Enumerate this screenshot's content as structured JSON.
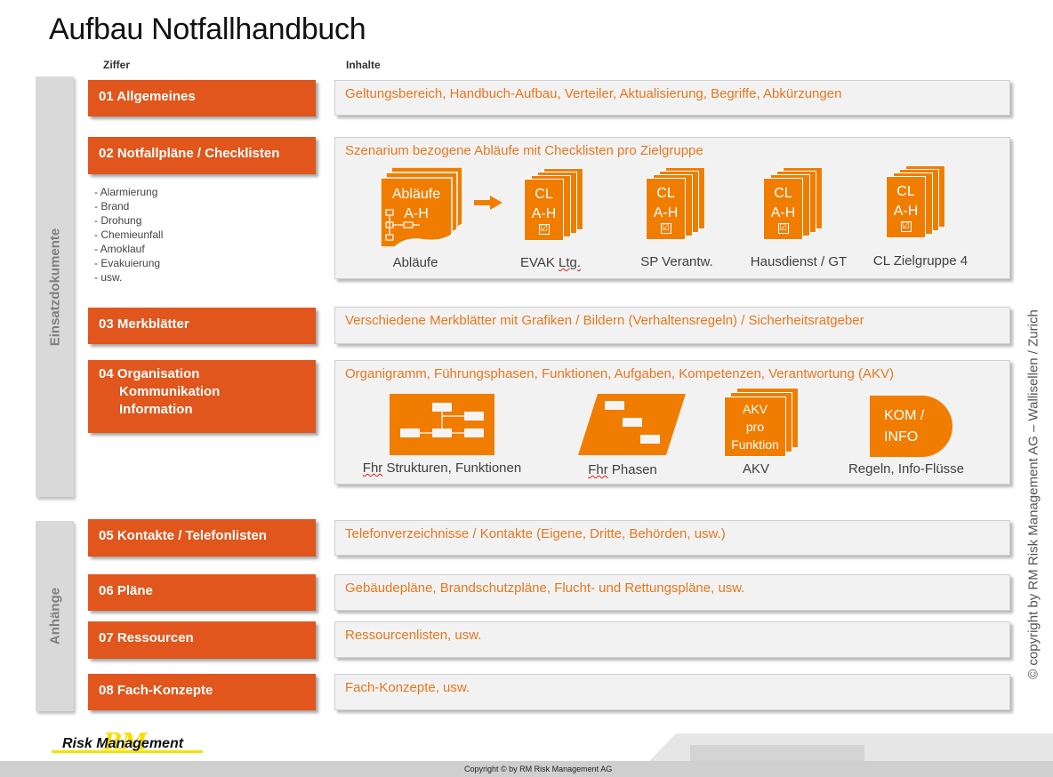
{
  "title": "Aufbau Notfallhandbuch",
  "headers": {
    "ziffer": "Ziffer",
    "inhalte": "Inhalte"
  },
  "sidebars": {
    "einsatz": "Einsatzdokumente",
    "anhaenge": "Anhänge"
  },
  "items": {
    "i01": "01  Allgemeines",
    "i02": "02 Notfallpläne / Checklisten",
    "i03": "03 Merkblätter",
    "i04": {
      "l1": "04 Organisation",
      "l2": "Kommunikation",
      "l3": "Information"
    },
    "i05": "05 Kontakte / Telefonlisten",
    "i06": "06 Pläne",
    "i07": "07 Ressourcen",
    "i08": "08 Fach-Konzepte"
  },
  "sublist": [
    "- Alarmierung",
    "- Brand",
    "- Drohung",
    "- Chemieunfall",
    "- Amoklauf",
    "- Evakuierung",
    "- usw."
  ],
  "contents": {
    "c01": "Geltungsbereich, Handbuch-Aufbau, Verteiler, Aktualisierung, Begriffe, Abkürzungen",
    "c02": "Szenarium bezogene Abläufe mit Checklisten pro Zielgruppe",
    "c03": "Verschiedene Merkblätter mit Grafiken / Bildern (Verhaltensregeln) / Sicherheitsratgeber",
    "c04": "Organigramm, Führungsphasen, Funktionen, Aufgaben, Kompetenzen, Verantwortung (AKV)",
    "c05": "Telefonverzeichnisse / Kontakte (Eigene, Dritte, Behörden, usw.)",
    "c06": "Gebäudepläne, Brandschutzpläne, Flucht- und Rettungspläne, usw.",
    "c07": "Ressourcenlisten, usw.",
    "c08": "Fach-Konzepte, usw."
  },
  "row2_graphics": {
    "ablaeufe_icon": {
      "l1": "Abläufe",
      "l2": "A-H"
    },
    "cl_icon": {
      "l1": "CL",
      "l2": "A-H",
      "check": "☑"
    },
    "captions": {
      "ablaeufe": "Abläufe",
      "evak_a": "EVAK",
      "evak_b": "Ltg.",
      "sp": "SP Verantw.",
      "haus": "Hausdienst / GT",
      "cl4": "CL Zielgruppe 4"
    }
  },
  "row4_graphics": {
    "akv_icon": {
      "l1": "AKV",
      "l2": "pro",
      "l3": "Funktion"
    },
    "kom_icon": {
      "l1": "KOM /",
      "l2": "INFO"
    },
    "captions": {
      "fhr1_a": "Fhr",
      "fhr1_b": "Strukturen, Funktionen",
      "fhr2_a": "Fhr",
      "fhr2_b": "Phasen",
      "akv": "AKV",
      "regeln": "Regeln, Info-Flüsse"
    }
  },
  "logo": {
    "text": "Risk Management",
    "mark": "RM"
  },
  "copyright_vertical": "© copyright by RM Risk Management AG – Wallisellen / Zurich",
  "footer_copyright": "Copyright © by RM Risk Management AG",
  "colors": {
    "accent": "#e0561c",
    "orange_text": "#e8771e",
    "icon_orange": "#f07d00",
    "sidebar": "#d9d9d9"
  }
}
